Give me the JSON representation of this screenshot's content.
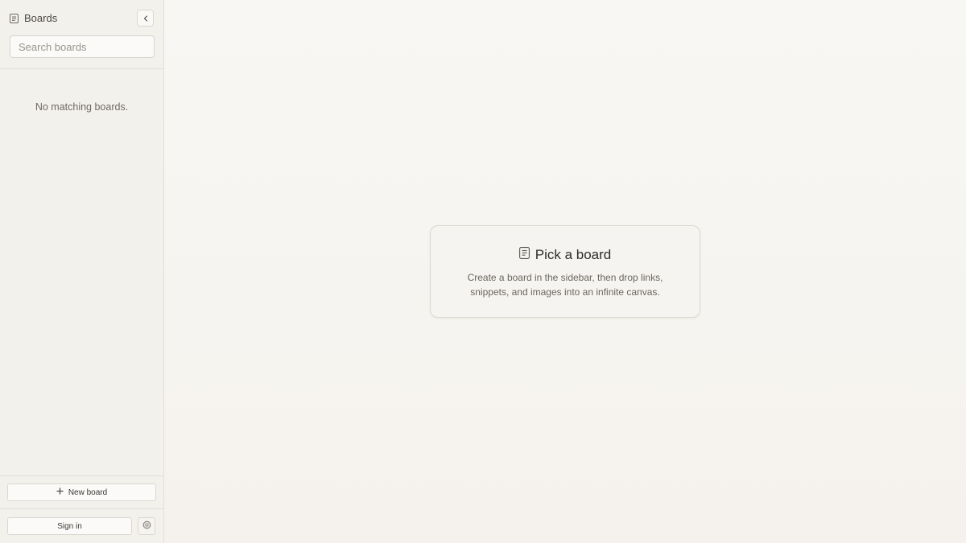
{
  "sidebar": {
    "title": "Boards",
    "search_placeholder": "Search boards",
    "search_value": "",
    "empty_message": "No matching boards.",
    "new_board_label": "New board",
    "sign_in_label": "Sign in",
    "icons": {
      "header": "board-icon",
      "collapse": "chevron-left-icon",
      "new_board": "plus-icon",
      "settings": "gear-icon"
    }
  },
  "main": {
    "card": {
      "title": "Pick a board",
      "description": "Create a board in the sidebar, then drop links, snippets, and images into an infinite canvas.",
      "icon": "board-icon"
    }
  },
  "colors": {
    "sidebar_bg": "#f3f1ec",
    "main_bg": "#f7f5f1",
    "border": "#dcd8d0",
    "text": "#3b3935",
    "muted_text": "#6a665f"
  }
}
